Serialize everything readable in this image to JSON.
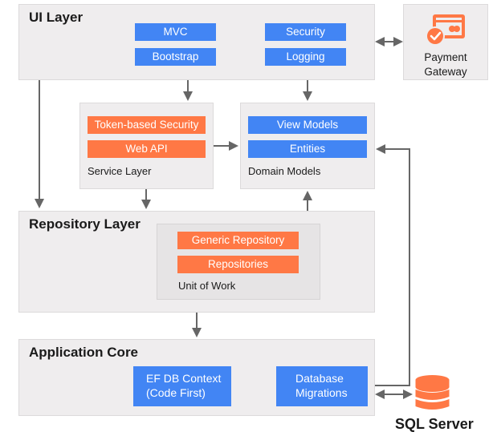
{
  "colors": {
    "blue": "#4285f4",
    "orange": "#ff7845",
    "panel": "#efedee",
    "arrow": "#666666"
  },
  "ui_layer": {
    "title": "UI Layer",
    "items": [
      "MVC",
      "Bootstrap",
      "Security",
      "Logging"
    ]
  },
  "payment_gateway": {
    "icon": "credit-card-check-icon",
    "label_line1": "Payment",
    "label_line2": "Gateway"
  },
  "service_layer": {
    "title": "Service Layer",
    "items": [
      "Token-based Security",
      "Web API"
    ]
  },
  "domain_models": {
    "title": "Domain Models",
    "items": [
      "View Models",
      "Entities"
    ]
  },
  "repository_layer": {
    "title": "Repository Layer",
    "unit_of_work": {
      "title": "Unit of Work",
      "items": [
        "Generic Repository",
        "Repositories"
      ]
    }
  },
  "application_core": {
    "title": "Application Core",
    "items": [
      {
        "line1": "EF DB Context",
        "line2": "(Code First)"
      },
      {
        "line1": "Database",
        "line2": "Migrations"
      }
    ]
  },
  "sql_server": {
    "icon": "database-icon",
    "label": "SQL Server"
  }
}
